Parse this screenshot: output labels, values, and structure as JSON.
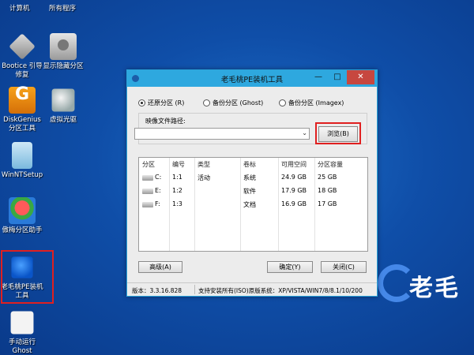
{
  "desktop": {
    "top_labels": [
      "计算机",
      "所有程序"
    ],
    "icons": [
      {
        "name": "bootice",
        "label_1": "Bootice 引导",
        "label_2": "修复"
      },
      {
        "name": "show-hidden-partition",
        "label_1": "显示隐藏分区",
        "label_2": ""
      },
      {
        "name": "diskgenius",
        "label_1": "DiskGenius",
        "label_2": "分区工具"
      },
      {
        "name": "virtual-cd",
        "label_1": "虚拟光驱",
        "label_2": ""
      },
      {
        "name": "winntsetup",
        "label_1": "WinNTSetup",
        "label_2": ""
      },
      {
        "name": "partition-assistant",
        "label_1": "傲梅分区助手",
        "label_2": ""
      },
      {
        "name": "laomaotao-pe-installer",
        "label_1": "老毛桃PE装机",
        "label_2": "工具"
      },
      {
        "name": "manual-ghost",
        "label_1": "手动运行",
        "label_2": "Ghost"
      }
    ],
    "watermark_text": "老毛"
  },
  "window": {
    "title": "老毛桃PE装机工具",
    "min_glyph": "—",
    "max_glyph": "□",
    "close_glyph": "✕",
    "radios": [
      {
        "label": "还原分区 (R)",
        "selected": true
      },
      {
        "label": "备份分区 (Ghost)",
        "selected": false
      },
      {
        "label": "备份分区 (Imagex)",
        "selected": false
      }
    ],
    "image_path_label": "映像文件路径:",
    "image_path_value": "",
    "dropdown_glyph": "⌄",
    "browse_label": "浏览(B)",
    "table": {
      "headers": [
        "分区",
        "编号",
        "类型",
        "卷标",
        "可用空间",
        "分区容量"
      ],
      "rows": [
        [
          "C:",
          "1:1",
          "活动",
          "系统",
          "24.9 GB",
          "25 GB"
        ],
        [
          "E:",
          "1:2",
          "",
          "软件",
          "17.9 GB",
          "18 GB"
        ],
        [
          "F:",
          "1:3",
          "",
          "文档",
          "16.9 GB",
          "17 GB"
        ]
      ]
    },
    "advanced_label": "高级(A)",
    "ok_label": "确定(Y)",
    "close_label": "关闭(C)",
    "version_text": "版本：3.3.16.828",
    "support_text": "支持安装所有(ISO)原版系统：XP/VISTA/WIN7/8/8.1/10/200"
  },
  "colors": {
    "desktop_bg": "#0f4ea8",
    "titlebar": "#2ea8df",
    "close_button": "#c7473f",
    "highlight_box": "#e02020"
  }
}
